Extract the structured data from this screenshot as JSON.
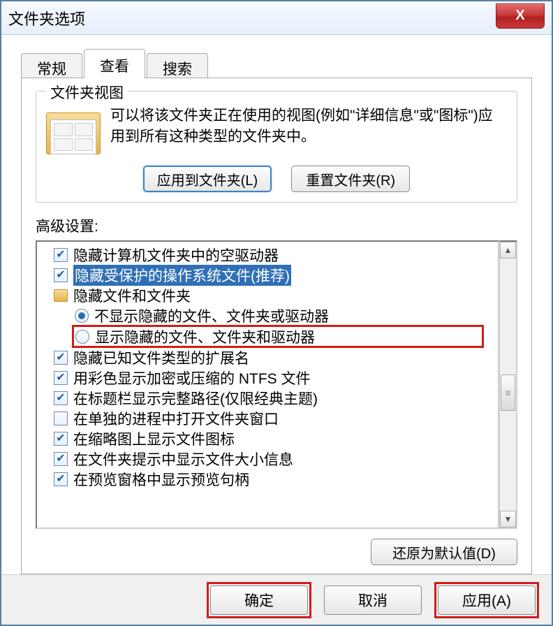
{
  "window": {
    "title": "文件夹选项",
    "close_glyph": "X"
  },
  "tabs": {
    "general": "常规",
    "view": "查看",
    "search": "搜索"
  },
  "folderview": {
    "legend": "文件夹视图",
    "desc": "可以将该文件夹正在使用的视图(例如\"详细信息\"或\"图标\")应用到所有这种类型的文件夹中。",
    "apply_btn": "应用到文件夹(L)",
    "reset_btn": "重置文件夹(R)"
  },
  "advanced": {
    "label": "高级设置:",
    "items": [
      {
        "type": "checkbox",
        "checked": true,
        "label": "隐藏计算机文件夹中的空驱动器"
      },
      {
        "type": "checkbox",
        "checked": true,
        "label": "隐藏受保护的操作系统文件(推荐)",
        "selected": true
      },
      {
        "type": "folder",
        "label": "隐藏文件和文件夹"
      },
      {
        "type": "radio",
        "checked": true,
        "label": "不显示隐藏的文件、文件夹或驱动器",
        "level": 2
      },
      {
        "type": "radio",
        "checked": false,
        "label": "显示隐藏的文件、文件夹和驱动器",
        "level": 2,
        "highlight": true
      },
      {
        "type": "checkbox",
        "checked": true,
        "label": "隐藏已知文件类型的扩展名"
      },
      {
        "type": "checkbox",
        "checked": true,
        "label": "用彩色显示加密或压缩的 NTFS 文件"
      },
      {
        "type": "checkbox",
        "checked": true,
        "label": "在标题栏显示完整路径(仅限经典主题)"
      },
      {
        "type": "checkbox",
        "checked": false,
        "label": "在单独的进程中打开文件夹窗口"
      },
      {
        "type": "checkbox",
        "checked": true,
        "label": "在缩略图上显示文件图标"
      },
      {
        "type": "checkbox",
        "checked": true,
        "label": "在文件夹提示中显示文件大小信息"
      },
      {
        "type": "checkbox",
        "checked": true,
        "label": "在预览窗格中显示预览句柄"
      }
    ],
    "restore_btn": "还原为默认值(D)"
  },
  "buttons": {
    "ok": "确定",
    "cancel": "取消",
    "apply": "应用(A)"
  }
}
